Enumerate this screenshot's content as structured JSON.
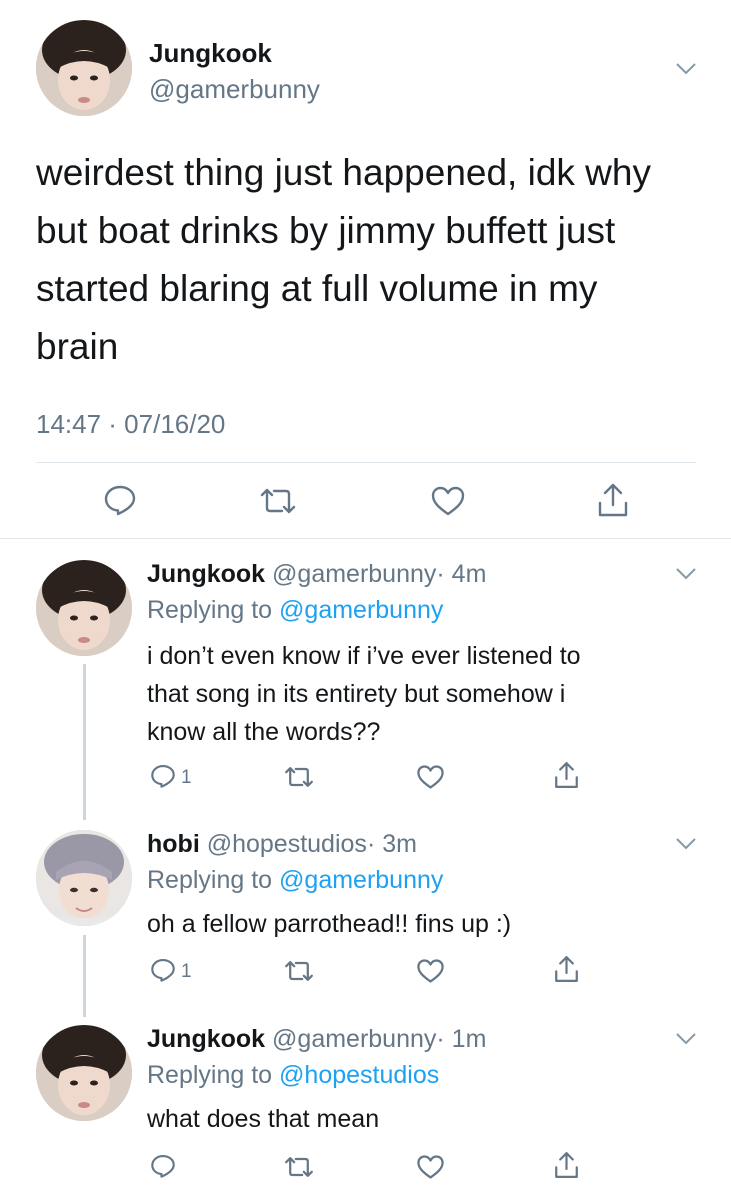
{
  "main_tweet": {
    "name": "Jungkook",
    "handle": "@gamerbunny",
    "text_lines": [
      "weirdest thing just happened, idk why",
      "but boat drinks by jimmy buffett just",
      "started blaring at full volume in my",
      "brain"
    ],
    "timestamp": "14:47 · 07/16/20",
    "actions": [
      "reply-icon",
      "retweet-icon",
      "like-icon",
      "share-icon"
    ]
  },
  "replies": [
    {
      "name": "Jungkook",
      "handle": "@gamerbunny",
      "age": "· 4m",
      "replying_prefix": "Replying to ",
      "replying_to": "@gamerbunny",
      "text_lines": [
        "i don’t even know if i’ve ever listened to",
        "that song in its entirety but somehow i",
        "know all the words??"
      ],
      "reply_count": "1"
    },
    {
      "name": "hobi",
      "handle": "@hopestudios",
      "age": "· 3m",
      "replying_prefix": "Replying to ",
      "replying_to": "@gamerbunny",
      "text_lines": [
        "oh a fellow parrothead!! fins up :)"
      ],
      "reply_count": "1"
    },
    {
      "name": "Jungkook",
      "handle": "@gamerbunny",
      "age": "· 1m",
      "replying_prefix": "Replying to ",
      "replying_to": "@hopestudios",
      "text_lines": [
        "what does that mean"
      ],
      "reply_count": ""
    }
  ],
  "colors": {
    "text": "#14171a",
    "secondary": "#657786",
    "link": "#1da1f2",
    "divider": "#e1e8ed"
  }
}
